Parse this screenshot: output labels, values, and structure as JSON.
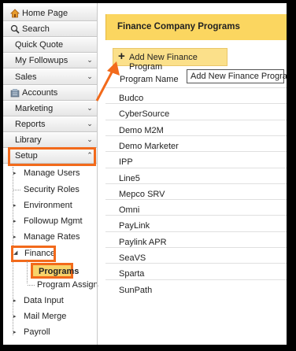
{
  "sidebar": {
    "home": "Home Page",
    "search": "Search",
    "quick_quote": "Quick Quote",
    "my_followups": "My Followups",
    "sales": "Sales",
    "accounts": "Accounts",
    "marketing": "Marketing",
    "reports": "Reports",
    "library": "Library",
    "setup": "Setup",
    "tree": {
      "manage_users": "Manage Users",
      "security_roles": "Security Roles",
      "environment": "Environment",
      "followup_mgmt": "Followup Mgmt",
      "manage_rates": "Manage Rates",
      "finance": "Finance",
      "programs": "Programs",
      "program_assign": "Program Assignm",
      "data_input": "Data Input",
      "mail_merge": "Mail Merge",
      "payroll": "Payroll"
    }
  },
  "main": {
    "title": "Finance Company Programs",
    "add_button": "Add New Finance Program",
    "tooltip": "Add New Finance Program",
    "column_header": "Program Name",
    "programs": [
      "Budco",
      "CyberSource",
      "Demo M2M",
      "Demo Marketer",
      "IPP",
      "Line5",
      "Mepco SRV",
      "Omni",
      "PayLink",
      "Paylink APR",
      "SeaVS",
      "Sparta",
      "SunPath"
    ]
  },
  "colors": {
    "accent_orange": "#f26a1b",
    "title_yellow": "#fbd660",
    "selected_yellow": "#f7d36a"
  }
}
